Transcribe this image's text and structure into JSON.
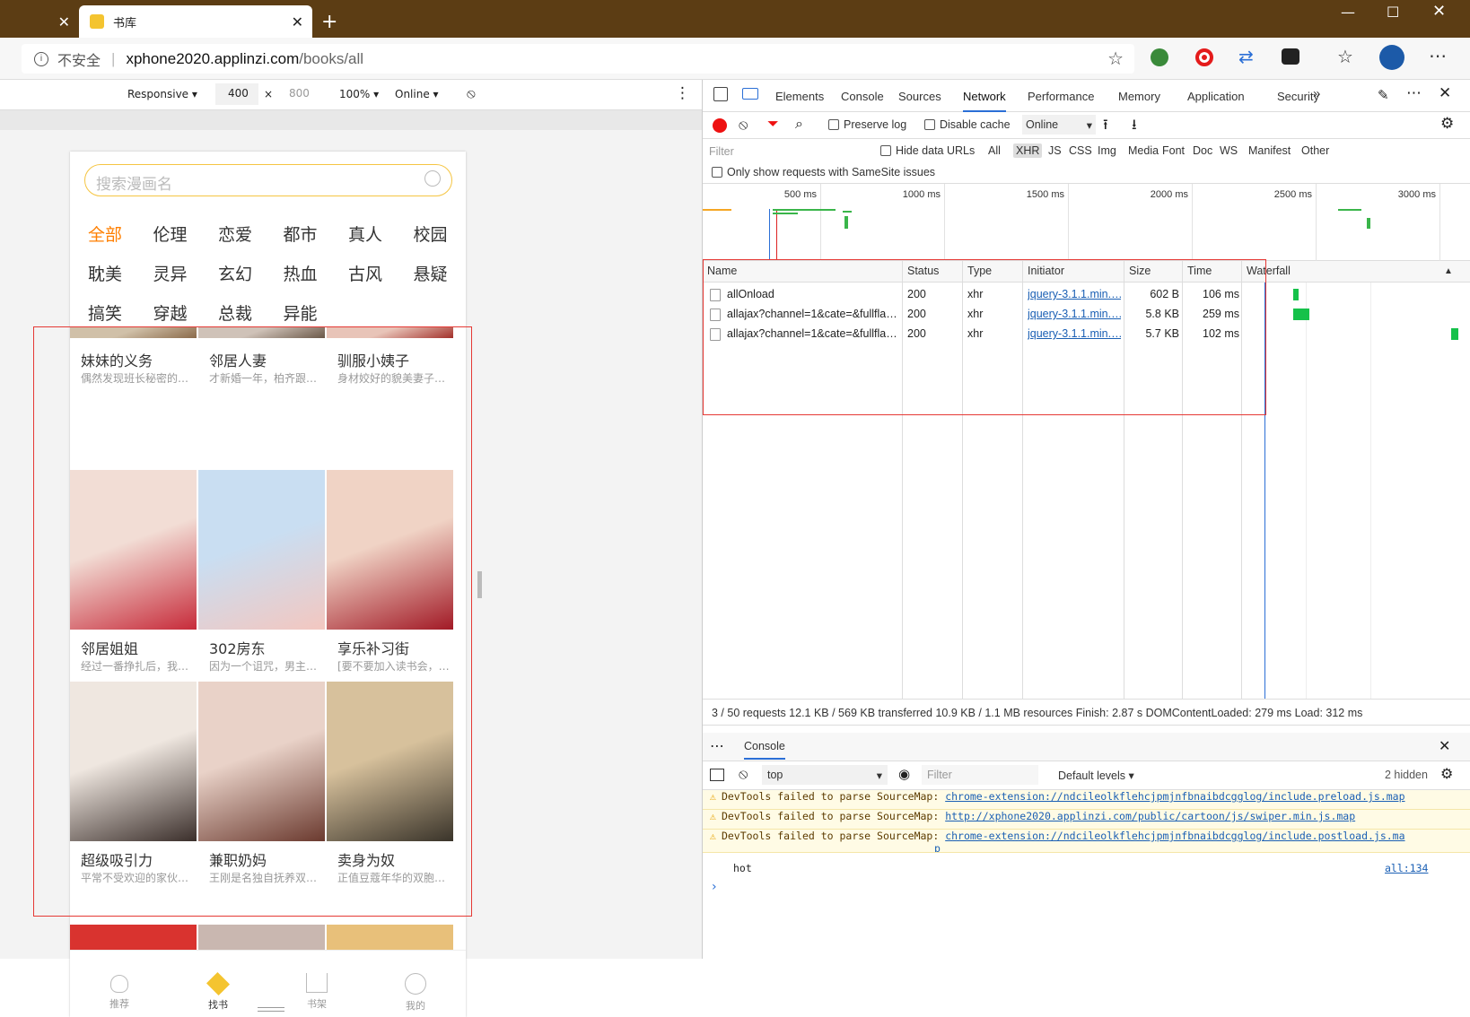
{
  "browser": {
    "tab_title": "书库",
    "new_tab": "+",
    "security_label": "不安全",
    "url_host": "xphone2020.applinzi.com",
    "url_path": "/books/all"
  },
  "device_toolbar": {
    "mode": "Responsive",
    "width": "400",
    "times": "×",
    "height": "800",
    "zoom": "100%",
    "throttle": "Online"
  },
  "app": {
    "search_placeholder": "搜索漫画名",
    "categories": [
      "全部",
      "伦理",
      "恋爱",
      "都市",
      "真人",
      "校园",
      "耽美",
      "灵异",
      "玄幻",
      "热血",
      "古风",
      "悬疑",
      "搞笑",
      "穿越",
      "总裁",
      "异能"
    ],
    "books": [
      {
        "title": "妹妹的义务",
        "desc": "偶然发现班长秘密的…"
      },
      {
        "title": "邻居人妻",
        "desc": "才新婚一年，柏齐跟太…"
      },
      {
        "title": "驯服小姨子",
        "desc": "身材姣好的貌美妻子，…"
      },
      {
        "title": "邻居姐姐",
        "desc": "经过一番挣扎后，我…"
      },
      {
        "title": "302房东",
        "desc": "因为一个诅咒，男主变…"
      },
      {
        "title": "享乐补习街",
        "desc": "[要不要加入读书会，…"
      },
      {
        "title": "超级吸引力",
        "desc": "平常不受欢迎的家伙…"
      },
      {
        "title": "兼职奶妈",
        "desc": "王刚是名独自抚养双胞…"
      },
      {
        "title": "卖身为奴",
        "desc": "正值豆蔻年华的双胞胎…"
      }
    ],
    "nav": [
      {
        "label": "推荐"
      },
      {
        "label": "找书"
      },
      {
        "label": "书架"
      },
      {
        "label": "我的"
      }
    ]
  },
  "devtools": {
    "tabs": [
      "Elements",
      "Console",
      "Sources",
      "Network",
      "Performance",
      "Memory",
      "Application",
      "Security"
    ],
    "active_tab": "Network",
    "more": "»",
    "preserve_log": "Preserve log",
    "disable_cache": "Disable cache",
    "throttle": "Online",
    "filter_placeholder": "Filter",
    "hide_data_urls": "Hide data URLs",
    "types": [
      "All",
      "XHR",
      "JS",
      "CSS",
      "Img",
      "Media",
      "Font",
      "Doc",
      "WS",
      "Manifest",
      "Other"
    ],
    "active_type": "XHR",
    "samesite": "Only show requests with SameSite issues",
    "timeline_ticks": [
      "500 ms",
      "1000 ms",
      "1500 ms",
      "2000 ms",
      "2500 ms",
      "3000 ms"
    ],
    "columns": [
      "Name",
      "Status",
      "Type",
      "Initiator",
      "Size",
      "Time",
      "Waterfall"
    ],
    "rows": [
      {
        "name": "allOnload",
        "status": "200",
        "type": "xhr",
        "initiator": "jquery-3.1.1.min.…",
        "size": "602 B",
        "time": "106 ms"
      },
      {
        "name": "allajax?channel=1&cate=&fullfla…",
        "status": "200",
        "type": "xhr",
        "initiator": "jquery-3.1.1.min.…",
        "size": "5.8 KB",
        "time": "259 ms"
      },
      {
        "name": "allajax?channel=1&cate=&fullfla…",
        "status": "200",
        "type": "xhr",
        "initiator": "jquery-3.1.1.min.…",
        "size": "5.7 KB",
        "time": "102 ms"
      }
    ],
    "summary": "3 / 50 requests   12.1 KB / 569 KB transferred   10.9 KB / 1.1 MB resources   Finish: 2.87 s   DOMContentLoaded: 279 ms   Load: 312 ms",
    "drawer_tab": "Console",
    "console_context": "top",
    "console_filter": "Filter",
    "levels": "Default levels ▾",
    "hidden": "2 hidden",
    "messages": [
      {
        "prefix": "DevTools failed to parse SourceMap: ",
        "link": "chrome-extension://ndcileolkflehcjpmjnfbnaibdcgglog/include.preload.js.map"
      },
      {
        "prefix": "DevTools failed to parse SourceMap: ",
        "link": "http://xphone2020.applinzi.com/public/cartoon/js/swiper.min.js.map"
      },
      {
        "prefix": "DevTools failed to parse SourceMap: ",
        "link": "chrome-extension://ndcileolkflehcjpmjnfbnaibdcgglog/include.postload.js.ma",
        "link2": "p"
      }
    ],
    "log_text": "hot",
    "log_source": "all:134",
    "prompt": "›"
  },
  "colors": {
    "titlebar": "#5c3d14",
    "accent": "#ff7f00",
    "highlight": "#e53935",
    "link": "#1a5fb4"
  }
}
